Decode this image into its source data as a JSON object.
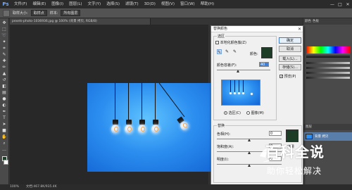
{
  "app": {
    "logo": "Ps"
  },
  "menu": [
    "文件(F)",
    "编辑(E)",
    "图像(I)",
    "图层(L)",
    "文字(Y)",
    "选择(S)",
    "滤镜(T)",
    "3D(D)",
    "视图(V)",
    "窗口(W)",
    "帮助(H)"
  ],
  "window_controls": [
    "—",
    "□",
    "✕"
  ],
  "options_bar": {
    "sample_size_label": "取样大小:",
    "sample_size_value": "取样点",
    "sample_label": "样本:",
    "sample_value": "所有图层"
  },
  "document_tab": "pexels-photo-1036936.jpg @ 100% (背景 拷贝, RGB/8)",
  "status_bar": {
    "zoom": "100%",
    "doc": "文档:467.8K/935.4K"
  },
  "right_panel": {
    "tabs": [
      "颜色",
      "色板"
    ],
    "layers_header": "图层",
    "layer_name": "背景 拷贝"
  },
  "dialog": {
    "title": "替换颜色",
    "close": "✕",
    "selection_group": "选区",
    "localized_clusters": "本地化颜色簇(Z)",
    "color_label": "颜色:",
    "fuzziness_label": "颜色容差(F):",
    "fuzziness_value": "40",
    "radio_selection": "选区(C)",
    "radio_image": "图像(M)",
    "replace_group": "替换",
    "hue_label": "色相(H):",
    "hue_value": "0",
    "saturation_label": "饱和度(A):",
    "saturation_value": "0",
    "lightness_label": "明度(I):",
    "lightness_value": "0",
    "result_label": "结果",
    "ok": "确定",
    "cancel": "取消",
    "load": "载入(L)...",
    "save": "存储(S)...",
    "preview": "预览(P)"
  },
  "watermark": {
    "title": "百科全说",
    "subtitle": "助你轻松解决"
  },
  "colors": {
    "selected_color": "#1e3d26",
    "accent": "#3f7fd6"
  },
  "icons": [
    "move-icon",
    "marquee-icon",
    "lasso-icon",
    "magic-wand-icon",
    "crop-icon",
    "eyedropper-icon",
    "healing-icon",
    "brush-icon",
    "stamp-icon",
    "history-brush-icon",
    "eraser-icon",
    "gradient-icon",
    "blur-icon",
    "dodge-icon",
    "pen-icon",
    "type-icon",
    "path-select-icon",
    "shape-icon",
    "hand-icon",
    "zoom-icon"
  ]
}
